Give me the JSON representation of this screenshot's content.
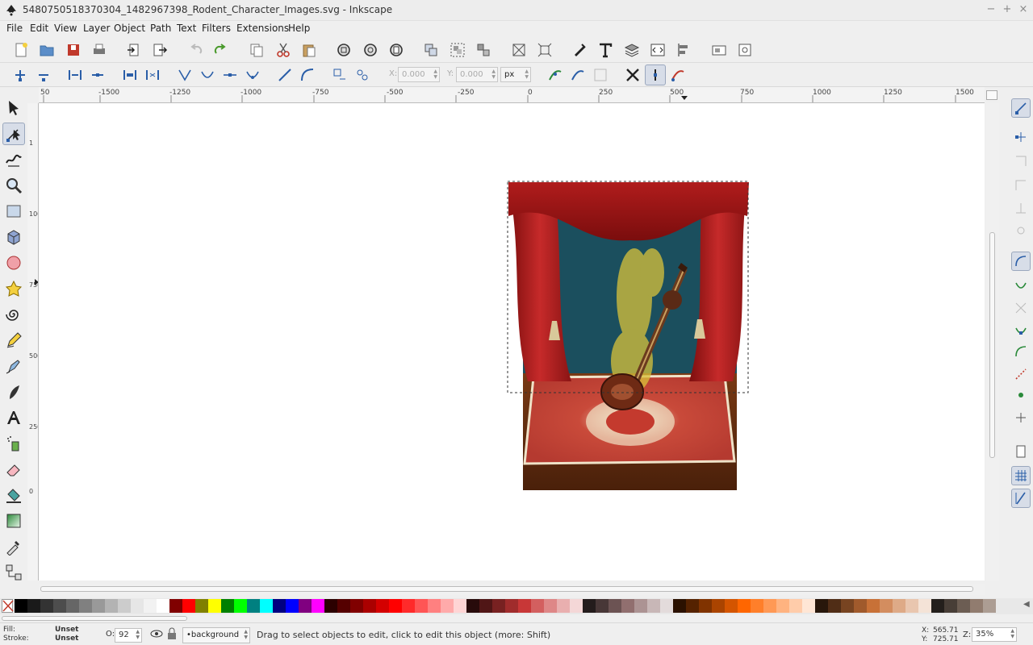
{
  "window": {
    "title": "5480750518370304_1482967398_Rodent_Character_Images.svg - Inkscape",
    "minimize": "−",
    "maximize": "+",
    "close": "×"
  },
  "menu": [
    "File",
    "Edit",
    "View",
    "Layer",
    "Object",
    "Path",
    "Text",
    "Filters",
    "Extensions",
    "Help"
  ],
  "node_toolbar": {
    "x_label": "X:",
    "x_value": "0.000",
    "y_label": "Y:",
    "y_value": "0.000",
    "unit": "px"
  },
  "ruler": {
    "h_ticks": [
      "50",
      "-1500",
      "-1250",
      "-1000",
      "-750",
      "-500",
      "-250",
      "0",
      "250",
      "500",
      "750",
      "1000",
      "1250",
      "1500"
    ],
    "v_ticks": [
      "1",
      "1000",
      "750",
      "500",
      "250",
      "0"
    ]
  },
  "status": {
    "fill_label": "Fill:",
    "fill_value": "Unset",
    "stroke_label": "Stroke:",
    "stroke_value": "Unset",
    "opacity_label": "O:",
    "opacity_value": "92",
    "layer": "•background",
    "message": "Drag to select objects to edit, click to edit this object (more: Shift)",
    "x_label": "X:",
    "x_value": "565.71",
    "y_label": "Y:",
    "y_value": "725.71",
    "zoom_label": "Z:",
    "zoom_value": "35%"
  },
  "palette_colors": [
    "#000000",
    "#1a1a1a",
    "#333333",
    "#4d4d4d",
    "#666666",
    "#808080",
    "#999999",
    "#b3b3b3",
    "#cccccc",
    "#e6e6e6",
    "#f2f2f2",
    "#ffffff",
    "#800000",
    "#ff0000",
    "#808000",
    "#ffff00",
    "#008000",
    "#00ff00",
    "#008080",
    "#00ffff",
    "#000080",
    "#0000ff",
    "#800080",
    "#ff00ff",
    "#2b0000",
    "#550000",
    "#800000",
    "#aa0000",
    "#d40000",
    "#ff0000",
    "#ff2a2a",
    "#ff5555",
    "#ff8080",
    "#ffaaaa",
    "#ffd5d5",
    "#280b0b",
    "#501616",
    "#782121",
    "#a02c2c",
    "#c83737",
    "#d35f5f",
    "#de8787",
    "#e9afaf",
    "#f4d7d7",
    "#241c1c",
    "#483737",
    "#6c5353",
    "#916f6f",
    "#ac9393",
    "#c8b7b7",
    "#e3dbdb",
    "#2b1100",
    "#552200",
    "#803300",
    "#aa4400",
    "#d45500",
    "#ff6600",
    "#ff7f2a",
    "#ff9955",
    "#ffb380",
    "#ffccaa",
    "#ffe6d5",
    "#28170b",
    "#502d16",
    "#784421",
    "#a05a2c",
    "#c87137",
    "#d38d5f",
    "#deaa87",
    "#e9c6af",
    "#f4e3d7",
    "#241f1c",
    "#483e37",
    "#6c5d53",
    "#917c6f",
    "#ac9d93"
  ]
}
